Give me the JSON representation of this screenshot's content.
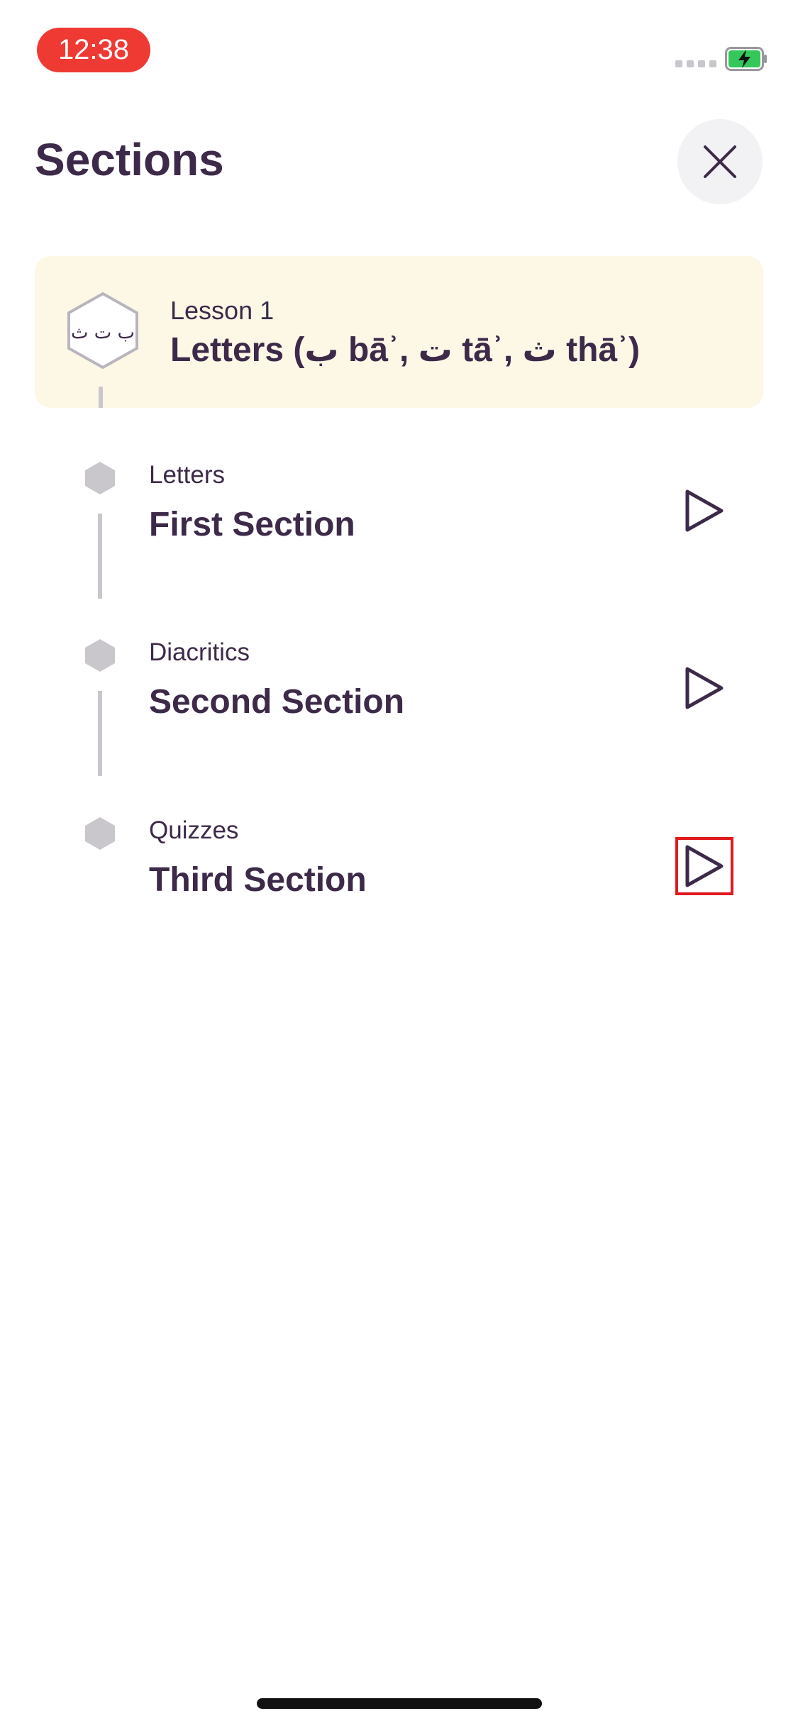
{
  "status_bar": {
    "time": "12:38"
  },
  "header": {
    "title": "Sections"
  },
  "lesson": {
    "number_label": "Lesson 1",
    "title": "Letters (ب bāʾ, ت tāʾ, ث thāʾ)",
    "badge_text": "ب ت ث"
  },
  "sections": [
    {
      "label": "Letters",
      "title": "First Section"
    },
    {
      "label": "Diacritics",
      "title": "Second Section"
    },
    {
      "label": "Quizzes",
      "title": "Third Section"
    }
  ],
  "colors": {
    "text": "#3d2a49",
    "card_bg": "#fdf7e6",
    "time_pill": "#ef3a33",
    "battery": "#34c759",
    "highlight": "#e0191e"
  },
  "icons": {
    "close": "close-icon",
    "play": "play-icon",
    "battery": "battery-charging-icon",
    "hexagon": "hexagon-icon"
  }
}
